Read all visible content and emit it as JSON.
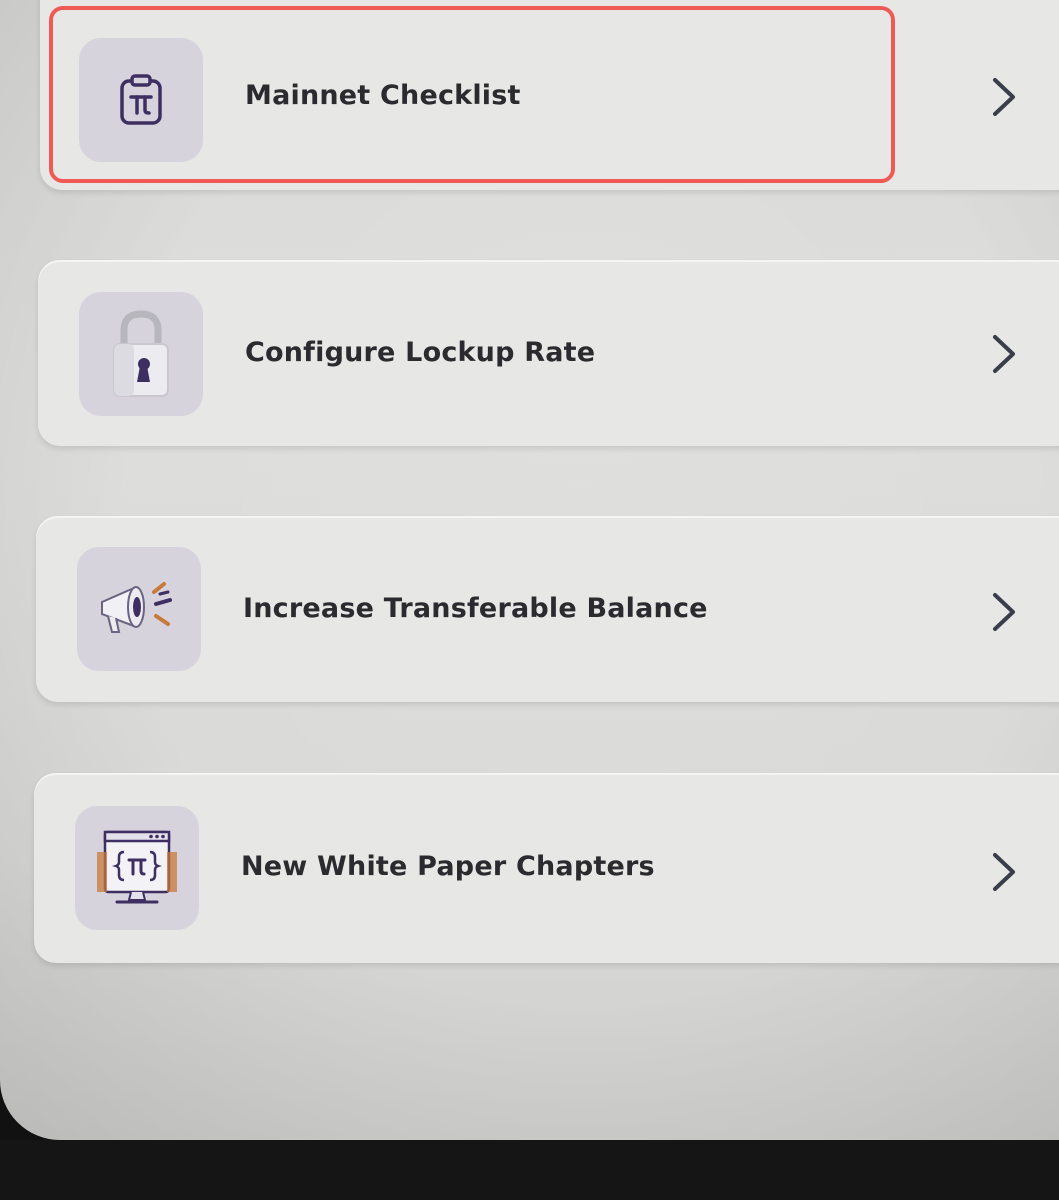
{
  "menu": {
    "items": [
      {
        "label": "Mainnet Checklist",
        "icon": "clipboard-pi-icon",
        "highlighted": true
      },
      {
        "label": "Configure Lockup Rate",
        "icon": "padlock-icon",
        "highlighted": false
      },
      {
        "label": "Increase Transferable Balance",
        "icon": "megaphone-icon",
        "highlighted": false
      },
      {
        "label": "New White Paper Chapters",
        "icon": "whitepaper-monitor-icon",
        "highlighted": false
      }
    ]
  },
  "colors": {
    "highlight": "#ef5a55",
    "icon_tile": "#d6d3dd",
    "icon_stroke": "#3e2f63",
    "accent_orange": "#c77a3a",
    "text": "#2b2b2f"
  }
}
